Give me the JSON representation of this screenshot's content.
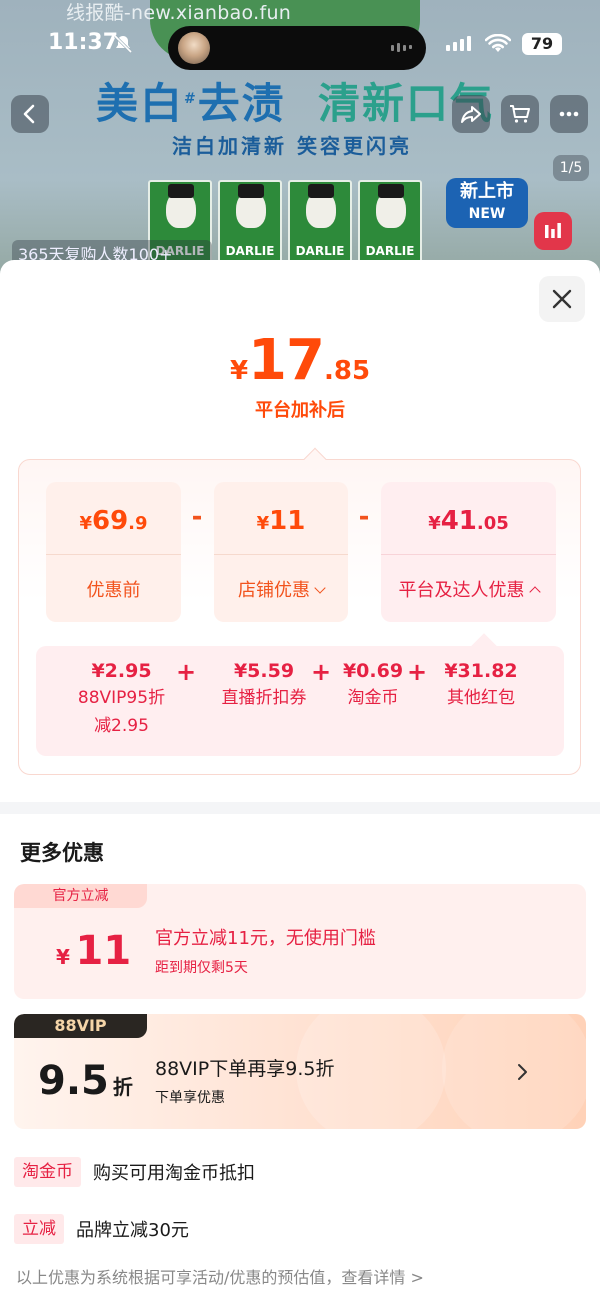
{
  "watermark": "线报酷-new.xianbao.fun",
  "status_bar": {
    "time": "11:37",
    "battery": "79"
  },
  "product_banner": {
    "headline_left": "美白",
    "headline_mark": "#",
    "headline_mid": "去渍",
    "headline_right": "清新口气",
    "subline": "洁白加清新 笑容更闪亮",
    "brand": "DARLIE",
    "new_badge_line1": "新上市",
    "new_badge_line2": "NEW",
    "pager": "1/5",
    "repurchase": "365天复购人数100+"
  },
  "summary": {
    "currency": "¥",
    "final_int": "17",
    "final_dec": ".85",
    "final_label": "平台加补后"
  },
  "breakdown": {
    "minus": "-",
    "cards": [
      {
        "currency": "¥",
        "int": "69",
        "dec": ".9",
        "label": "优惠前"
      },
      {
        "currency": "¥",
        "int": "11",
        "dec": "",
        "label": "店铺优惠"
      },
      {
        "currency": "¥",
        "int": "41",
        "dec": ".05",
        "label": "平台及达人优惠"
      }
    ],
    "plus": "+",
    "sub_items": [
      {
        "value": "¥2.95",
        "name_line1": "88VIP95折",
        "name_line2": "减2.95"
      },
      {
        "value": "¥5.59",
        "name_line1": "直播折扣券",
        "name_line2": ""
      },
      {
        "value": "¥0.69",
        "name_line1": "淘金币",
        "name_line2": ""
      },
      {
        "value": "¥31.82",
        "name_line1": "其他红包",
        "name_line2": ""
      }
    ]
  },
  "more": {
    "title": "更多优惠",
    "coupon_official": {
      "tag": "官方立减",
      "currency": "¥",
      "amount": "11",
      "title": "官方立减11元，无使用门槛",
      "subtitle": "距到期仅剩5天"
    },
    "coupon_vip": {
      "tag": "88VIP",
      "amount": "9.5",
      "unit": "折",
      "title": "88VIP下单再享9.5折",
      "subtitle": "下单享优惠"
    },
    "perks": [
      {
        "badge": "淘金币",
        "text": "购买可用淘金币抵扣"
      },
      {
        "badge": "立减",
        "text": "品牌立减30元"
      }
    ],
    "footnote": "以上优惠为系统根据可享活动/优惠的预估值，查看详情 >"
  },
  "colors": {
    "price_orange": "#ff4a0a",
    "platform_red": "#e62143",
    "vip_dark": "#2a2622"
  }
}
